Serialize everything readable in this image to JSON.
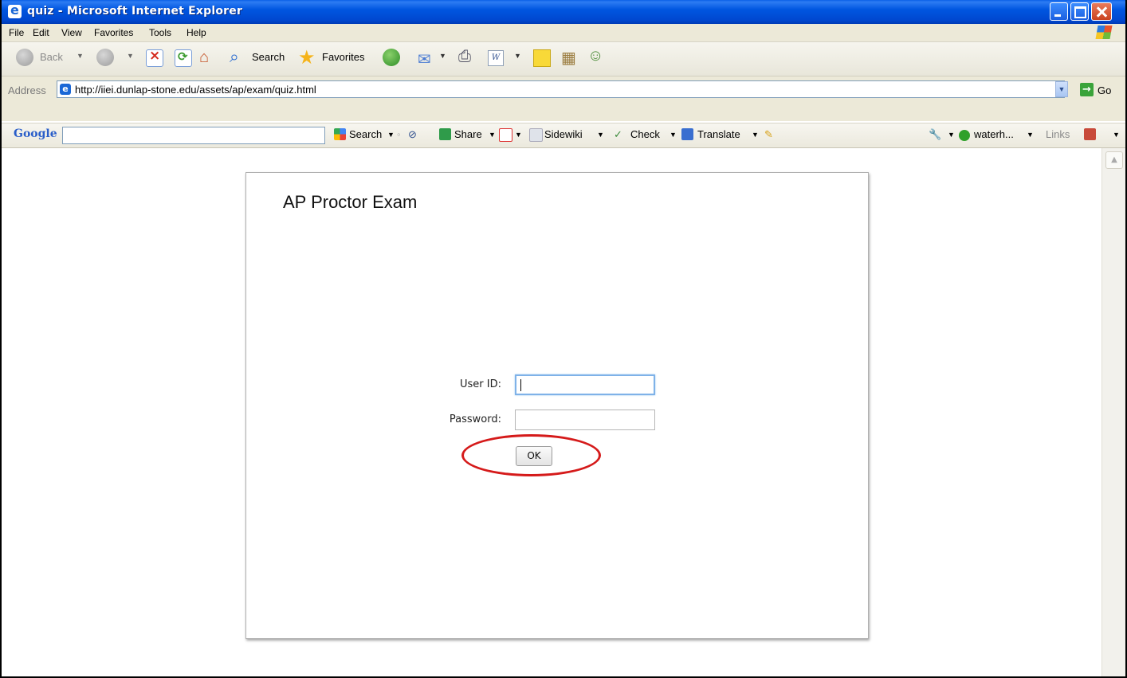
{
  "window": {
    "title": "quiz - Microsoft Internet Explorer"
  },
  "menu": [
    "File",
    "Edit",
    "View",
    "Favorites",
    "Tools",
    "Help"
  ],
  "toolbar": {
    "back_label": "Back",
    "search_label": "Search",
    "favorites_label": "Favorites"
  },
  "address": {
    "label": "Address",
    "url": "http://iiei.dunlap-stone.edu/assets/ap/exam/quiz.html",
    "go_label": "Go"
  },
  "google_toolbar": {
    "logo": "Google",
    "search_label": "Search",
    "share_label": "Share",
    "sidewiki_label": "Sidewiki",
    "check_label": "Check",
    "translate_label": "Translate",
    "profile_label": "waterh...",
    "links_label": "Links"
  },
  "page": {
    "heading": "AP Proctor Exam",
    "user_id_label": "User ID:",
    "password_label": "Password:",
    "user_id_value": "",
    "password_value": "",
    "ok_label": "OK"
  },
  "colors": {
    "titlebar": "#0054e3",
    "highlight_ring": "#d51a1a",
    "focus_border": "#7fb2e8"
  }
}
